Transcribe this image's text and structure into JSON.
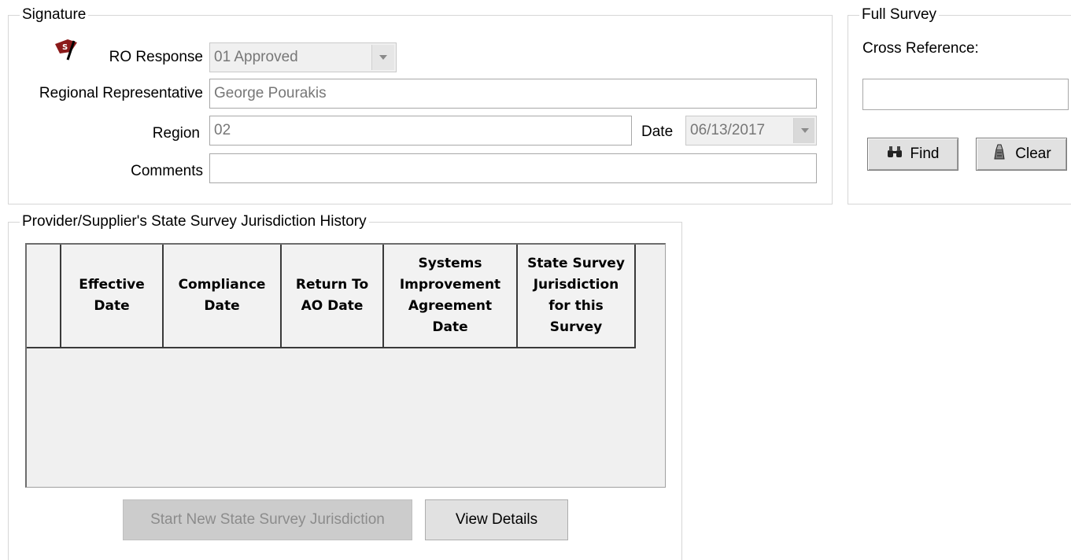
{
  "signature": {
    "title": "Signature",
    "ro_response_label": "RO Response",
    "ro_response_value": "01  Approved",
    "regional_rep_label": "Regional Representative",
    "regional_rep_value": "George Pourakis",
    "region_label": "Region",
    "region_value": "02",
    "date_label": "Date",
    "date_value": "06/13/2017",
    "comments_label": "Comments",
    "comments_value": "",
    "icon": "signature-flag-icon",
    "icon_color": "#8b1a1a"
  },
  "full_survey": {
    "title": "Full Survey",
    "cross_reference_label": "Cross Reference:",
    "cross_reference_value": "",
    "find_button": "Find",
    "clear_button": "Clear"
  },
  "history": {
    "title": "Provider/Supplier's State Survey Jurisdiction History",
    "columns": [
      "Effective\nDate",
      "Compliance\nDate",
      "Return To\nAO Date",
      "Systems\nImprovement\nAgreement\nDate",
      "State Survey\nJurisdiction\nfor this\nSurvey"
    ],
    "rows": [],
    "start_new_button": "Start New State Survey Jurisdiction",
    "view_details_button": "View Details"
  }
}
